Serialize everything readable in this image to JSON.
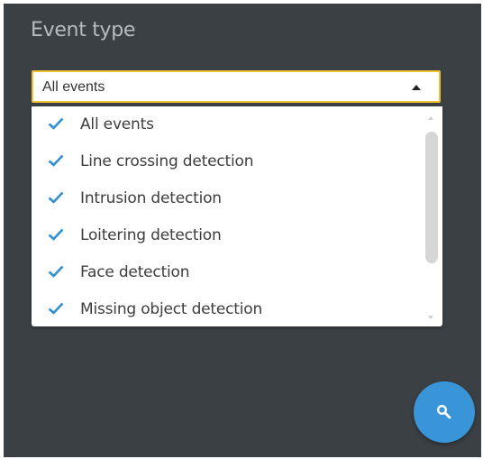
{
  "filter": {
    "title": "Event type",
    "selected_value": "All events"
  },
  "dropdown": {
    "options": [
      {
        "label": "All events",
        "checked": true
      },
      {
        "label": "Line crossing detection",
        "checked": true
      },
      {
        "label": "Intrusion detection",
        "checked": true
      },
      {
        "label": "Loitering detection",
        "checked": true
      },
      {
        "label": "Face detection",
        "checked": true
      },
      {
        "label": "Missing object detection",
        "checked": true
      }
    ]
  },
  "icons": {
    "check": "check-icon",
    "search": "search-icon",
    "arrow": "arrow-up-icon"
  },
  "colors": {
    "panel_background": "#3b4044",
    "accent_check": "#2f8fd3",
    "select_border": "#f0c230",
    "search_button": "#3a94d8"
  }
}
